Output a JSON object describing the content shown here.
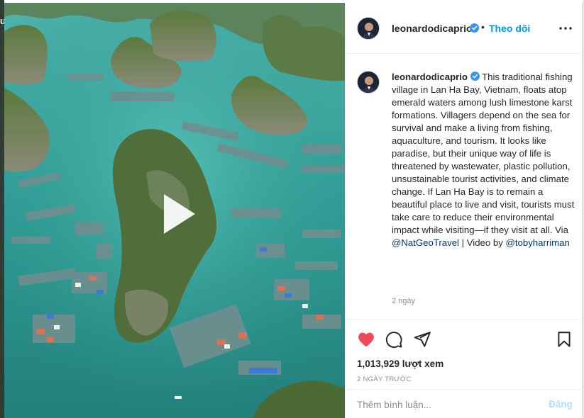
{
  "edge": {
    "glyph": "u"
  },
  "post": {
    "username": "leonardodicaprio",
    "follow_label": "Theo dõi",
    "separator": "•",
    "caption_text": "This traditional fishing village in Lan Ha Bay, Vietnam, floats atop emerald waters among lush limestone karst formations. Villagers depend on the sea for survival and make a living from fishing, aquaculture, and tourism. It looks like paradise, but their unique way of life is threatened by wastewater, plastic pollution, unsustainable tourist activities, and climate change. If Lan Ha Bay is to remain a beautiful place to live and visit, tourists must take care to reduce their environmental impact while visiting—if they visit at all. Via ",
    "mention_1": "@NatGeoTravel",
    "caption_mid": " | Video by ",
    "mention_2": "@tobyharriman",
    "time_ago": "2 ngày",
    "views": "1,013,929 lượt xem",
    "date": "2 NGÀY TRƯỚC"
  },
  "comment": {
    "placeholder": "Thêm bình luận...",
    "post_label": "Đăng"
  },
  "icons": {
    "verified": "verified-badge-icon",
    "more": "more-options-icon",
    "like": "heart-filled-icon",
    "comment": "comment-icon",
    "share": "share-icon",
    "save": "bookmark-icon",
    "play": "play-icon"
  },
  "colors": {
    "like": "#ed4956",
    "follow": "#0095f6",
    "verified": "#3897f0",
    "post_disabled": "#b2dffc",
    "mention": "#00376b"
  }
}
